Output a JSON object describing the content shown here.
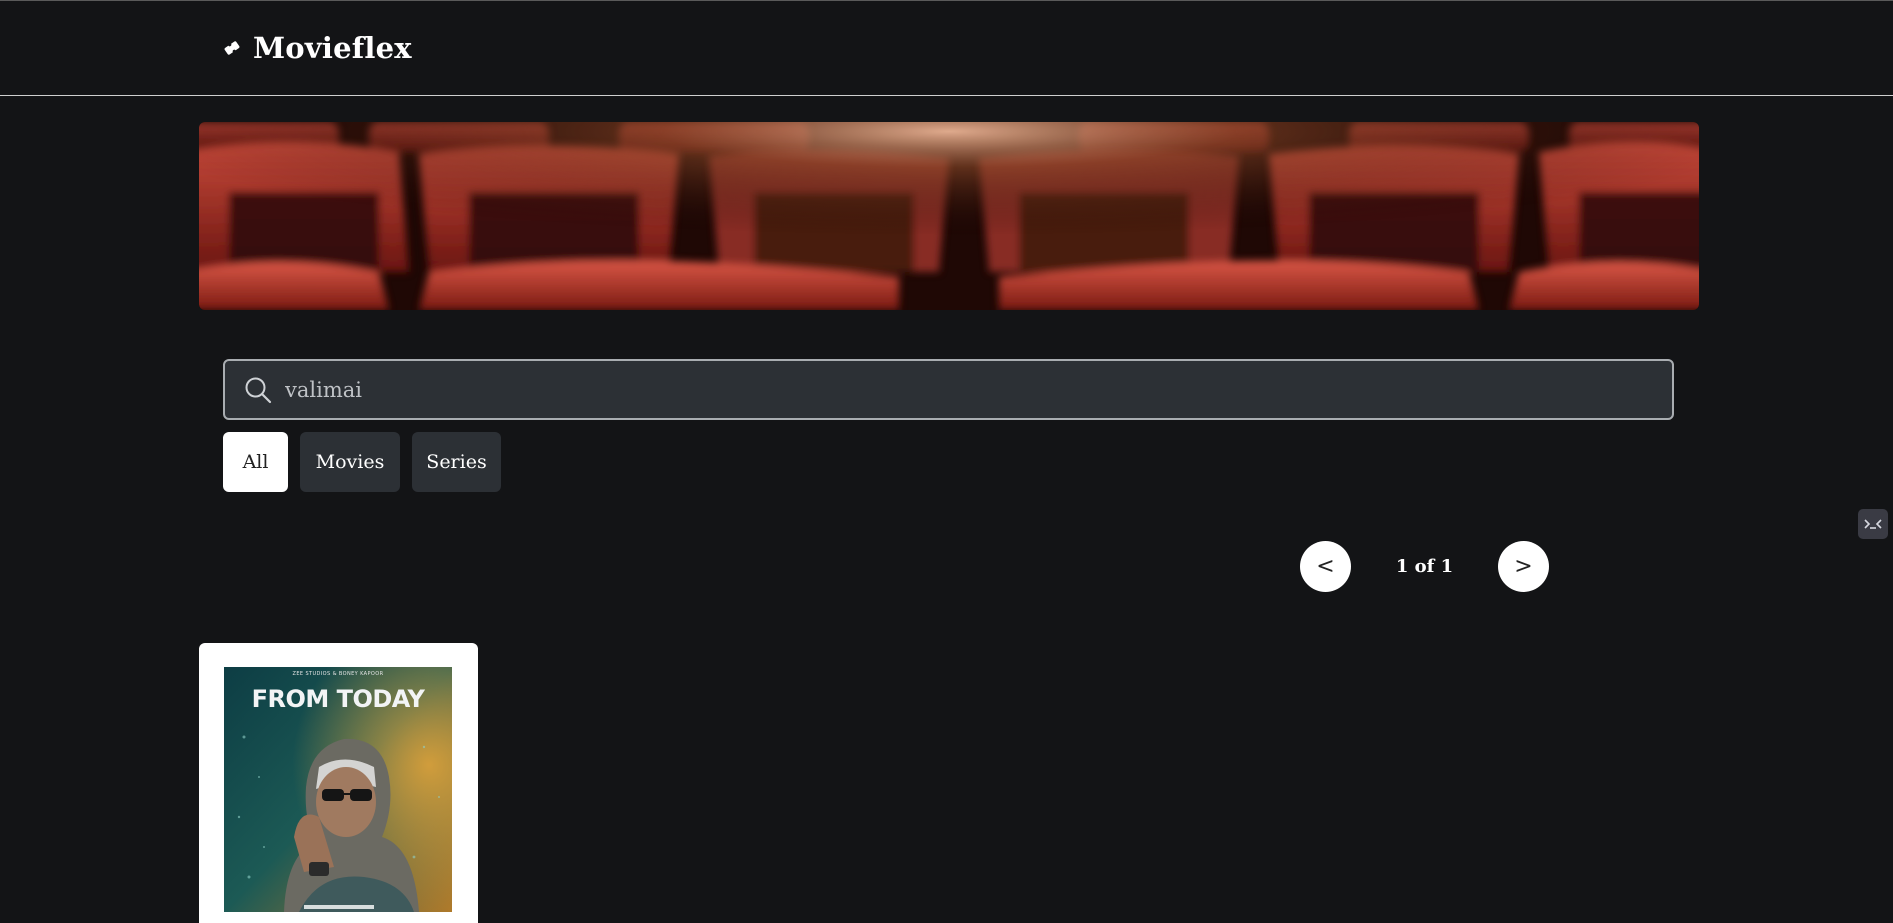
{
  "app": {
    "title": "Movieflex",
    "logo_icon": "ticket-icon"
  },
  "search": {
    "value": "valimai",
    "icon": "search-icon"
  },
  "filters": [
    {
      "label": "All",
      "active": true
    },
    {
      "label": "Movies",
      "active": false
    },
    {
      "label": "Series",
      "active": false
    }
  ],
  "pagination": {
    "prev_label": "<",
    "status": "1 of 1",
    "next_label": ">"
  },
  "results": [
    {
      "poster_credit": "ZEE STUDIOS & BONEY KAPOOR",
      "poster_headline": "FROM TODAY"
    }
  ],
  "colors": {
    "background": "#131416",
    "field": "#2c3035",
    "accent": "#ffffff"
  }
}
